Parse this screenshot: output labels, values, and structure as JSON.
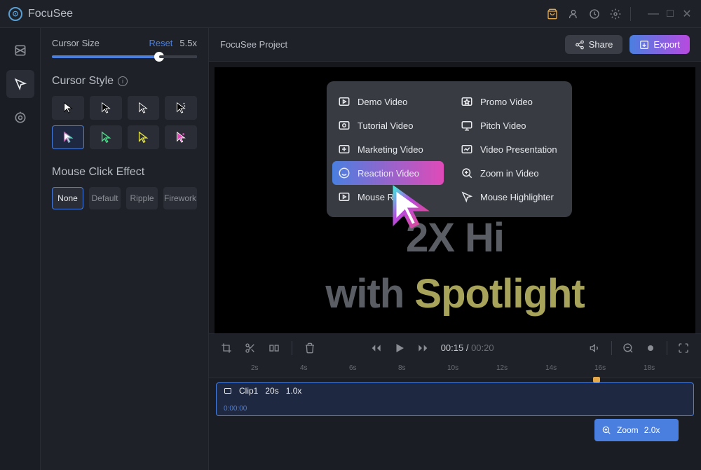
{
  "app": {
    "name": "FocuSee"
  },
  "header": {
    "project_name": "FocuSee Project",
    "share_label": "Share",
    "export_label": "Export"
  },
  "cursor_panel": {
    "size_label": "Cursor Size",
    "reset_label": "Reset",
    "size_value": "5.5x",
    "style_label": "Cursor Style",
    "effect_label": "Mouse Click Effect",
    "effects": [
      "None",
      "Default",
      "Ripple",
      "Firework"
    ]
  },
  "preview": {
    "text_line1_prefix": "2X Hi",
    "text_line2_prefix": "with ",
    "text_line2_accent": "Spotlight",
    "menu_items": [
      {
        "label": "Demo Video"
      },
      {
        "label": "Promo Video"
      },
      {
        "label": "Tutorial Video"
      },
      {
        "label": "Pitch Video"
      },
      {
        "label": "Marketing Video"
      },
      {
        "label": "Video Presentation"
      },
      {
        "label": "Reaction Video",
        "highlighted": true
      },
      {
        "label": "Zoom in Video"
      },
      {
        "label": "Mouse Re"
      },
      {
        "label": "Mouse Highlighter"
      }
    ]
  },
  "playback": {
    "current_time": "00:15",
    "total_time": "00:20"
  },
  "timeline": {
    "ticks": [
      "2s",
      "4s",
      "6s",
      "8s",
      "10s",
      "12s",
      "14s",
      "16s",
      "18s"
    ],
    "clip": {
      "name": "Clip1",
      "duration": "20s",
      "speed": "1.0x",
      "start": "0:00:00"
    },
    "zoom": {
      "label": "Zoom",
      "value": "2.0x"
    }
  }
}
